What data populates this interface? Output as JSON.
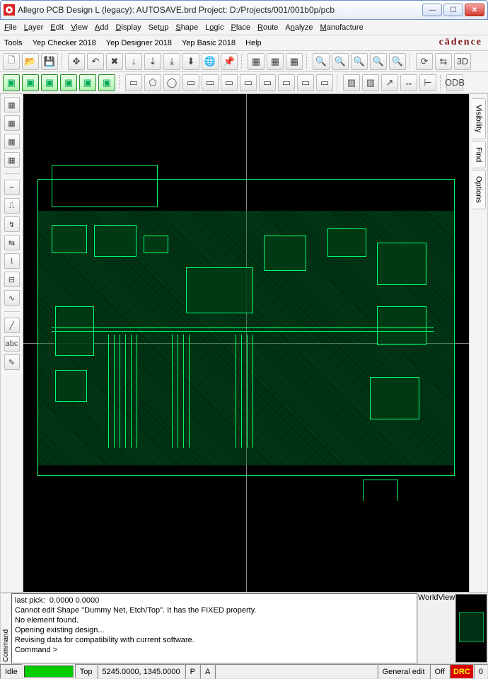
{
  "title": "Allegro PCB Design L (legacy): AUTOSAVE.brd  Project: D:/Projects/001/001b0p/pcb",
  "brand": "cādence",
  "menus1": [
    "File",
    "Layer",
    "Edit",
    "View",
    "Add",
    "Display",
    "Setup",
    "Shape",
    "Logic",
    "Place",
    "Route",
    "Analyze",
    "Manufacture"
  ],
  "menus2": [
    "Tools",
    "Yep Checker 2018",
    "Yep Designer 2018",
    "Yep Basic 2018",
    "Help"
  ],
  "sidetabs": [
    "Visibility",
    "Find",
    "Options"
  ],
  "consoleLabel": "Command",
  "console": "last pick:  0.0000 0.0000\nCannot edit Shape \"Dummy Net, Etch/Top\". It has the FIXED property.\nNo element found.\nOpening existing design...\nRevising data for compatibility with current software.\nCommand >",
  "worldLabel": "WorldView",
  "status": {
    "idle": "Idle",
    "layer": "Top",
    "coords": "5245.0000, 1345.0000",
    "p": "P",
    "a": "A",
    "mode": "General edit",
    "off": "Off",
    "drc": "DRC",
    "count": "0"
  },
  "icons": {
    "new": "🗋",
    "open": "📂",
    "save": "💾",
    "move": "✥",
    "undo": "↶",
    "cancel": "✖",
    "zoomin": "🔍+",
    "zoomout": "🔍−",
    "zoomfit": "🔍",
    "pin": "📌",
    "globe": "🌐",
    "3d": "3D",
    "rect": "▭",
    "poly": "⬠",
    "circle": "◯",
    "arrow": "↗",
    "dim": "↔",
    "angle": "∠",
    "odb": "ODB",
    "abc": "abc",
    "pen": "✎"
  }
}
